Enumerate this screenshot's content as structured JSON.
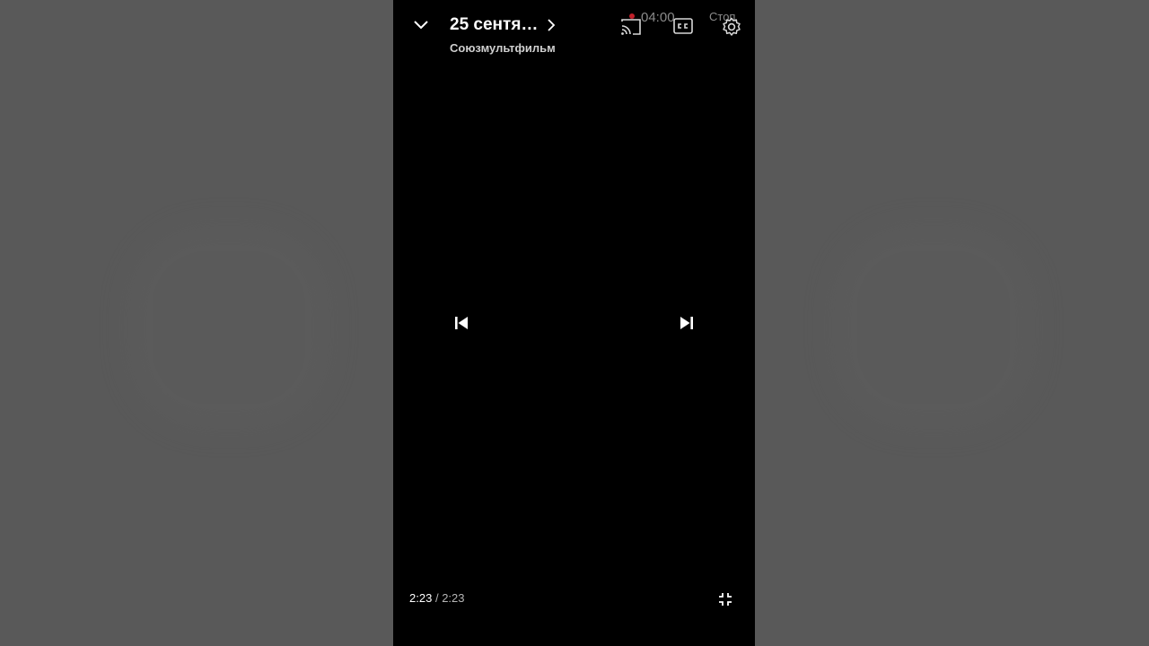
{
  "video": {
    "title": "25 сентяб...",
    "channel": "Союзмультфильм",
    "current_time": "2:23",
    "separator": "/",
    "duration": "2:23"
  },
  "status_bar": {
    "clock": "04:00",
    "right_text": "Стоп"
  },
  "icons": {
    "collapse": "chevron-down-icon",
    "title_more": "chevron-right-icon",
    "cast": "cast-icon",
    "captions": "closed-captions-icon",
    "settings": "gear-icon",
    "previous": "skip-previous-icon",
    "next": "skip-next-icon",
    "exit_fullscreen": "exit-fullscreen-icon"
  },
  "colors": {
    "player_background": "#000000",
    "page_background": "#595959",
    "recording_dot": "#c0202a"
  }
}
